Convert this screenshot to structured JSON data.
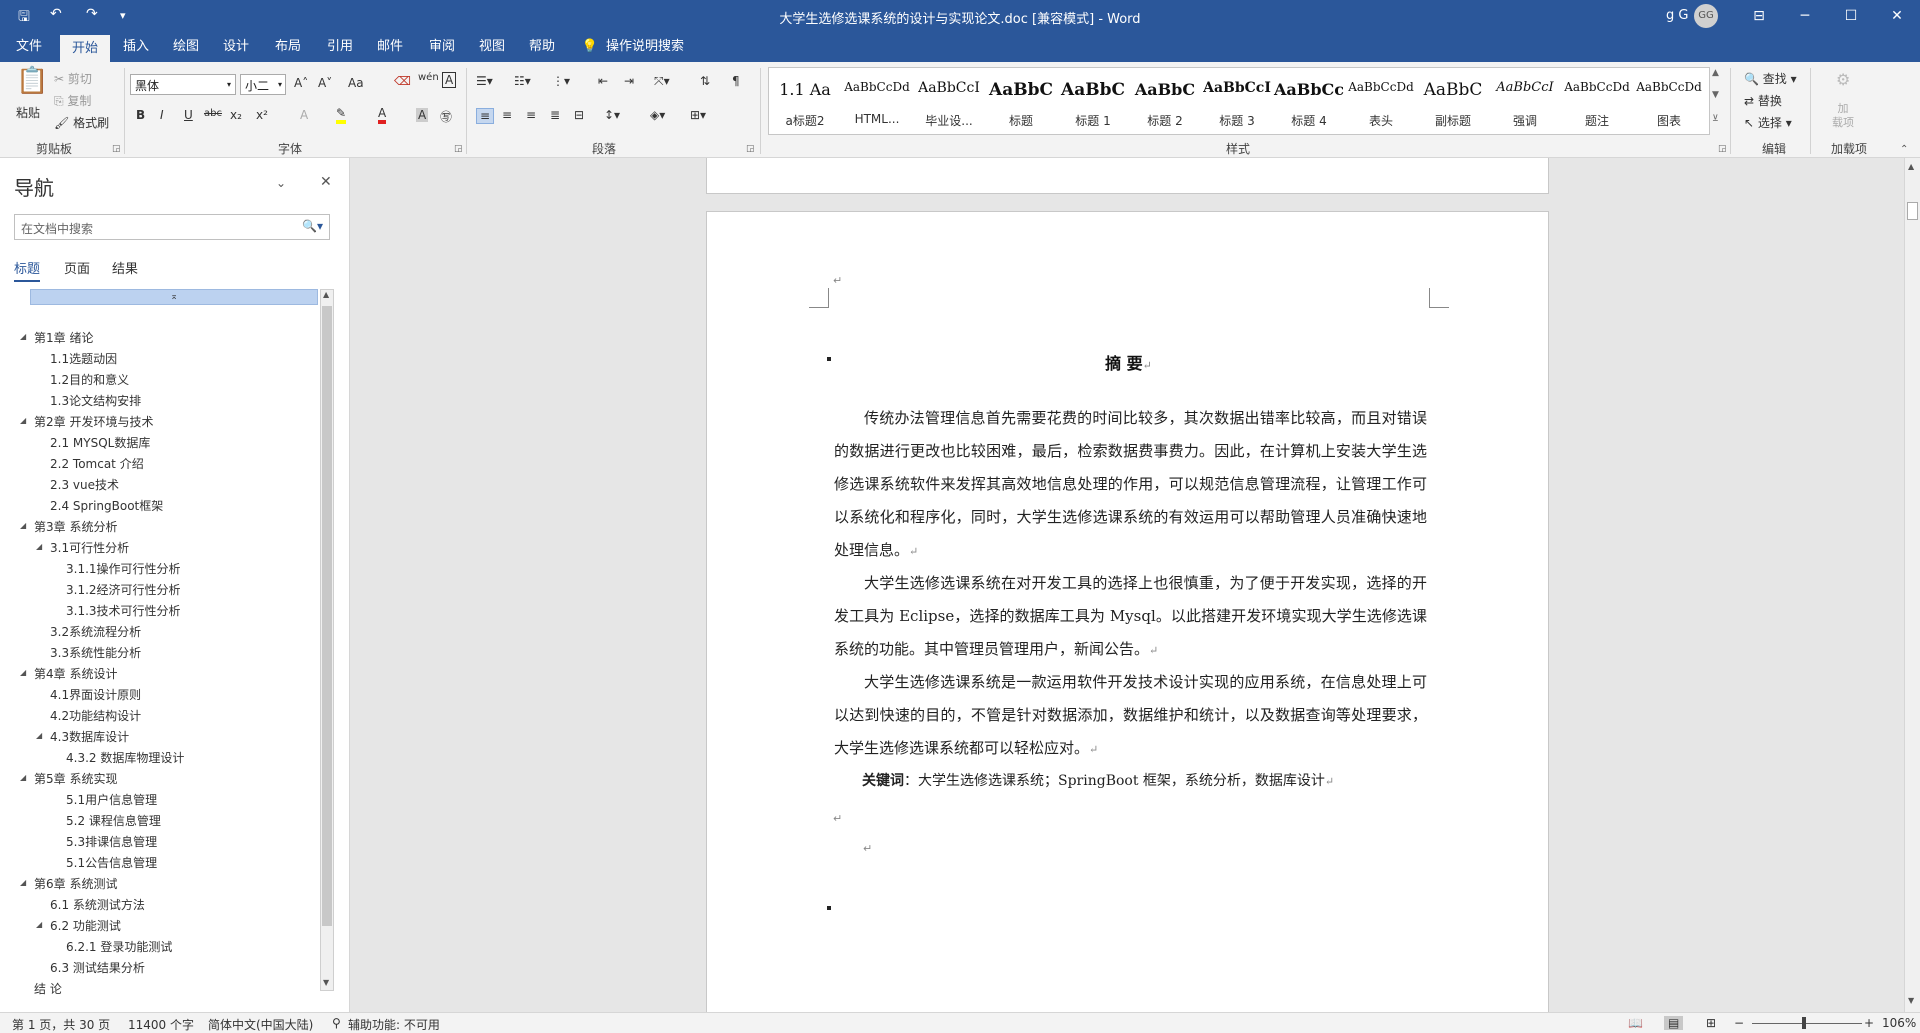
{
  "window": {
    "title": "大学生选修选课系统的设计与实现论文.doc [兼容模式] - Word",
    "user": "g G",
    "avatar_initials": "GG",
    "controls": {
      "minimize": "─",
      "maximize": "☐",
      "close": "✕",
      "ribbon_options": "⊟"
    }
  },
  "qat": {
    "save": "🖫",
    "undo": "↶",
    "redo": "↷",
    "customize": "▾"
  },
  "tabs": [
    "文件",
    "开始",
    "插入",
    "绘图",
    "设计",
    "布局",
    "引用",
    "邮件",
    "审阅",
    "视图",
    "帮助"
  ],
  "active_tab": "开始",
  "tell_me": "操作说明搜索",
  "ribbon": {
    "clipboard": {
      "paste": "粘贴",
      "cut": "剪切",
      "copy": "复制",
      "format_painter": "格式刷",
      "label": "剪贴板"
    },
    "font": {
      "name": "黑体",
      "size": "小二",
      "label": "字体",
      "grow": "A˄",
      "shrink": "A˅",
      "case": "Aa",
      "bold": "B",
      "italic": "I",
      "underline": "U",
      "strike": "abc",
      "sub": "x₂",
      "sup": "x²"
    },
    "paragraph": {
      "label": "段落"
    },
    "styles": {
      "label": "样式",
      "items": [
        {
          "preview": "1.1  Aa",
          "name": "a标题2"
        },
        {
          "preview": "AaBbCcDd",
          "name": "HTML..."
        },
        {
          "preview": "AaBbCcI",
          "name": "毕业设..."
        },
        {
          "preview": "AaBbC",
          "name": "标题"
        },
        {
          "preview": "AaBbC",
          "name": "标题 1"
        },
        {
          "preview": "AaBbC",
          "name": "标题 2"
        },
        {
          "preview": "AaBbCcI",
          "name": "标题 3"
        },
        {
          "preview": "AaBbCc",
          "name": "标题 4"
        },
        {
          "preview": "AaBbCcDd",
          "name": "表头"
        },
        {
          "preview": "AaBbC",
          "name": "副标题"
        },
        {
          "preview": "AaBbCcI",
          "name": "强调"
        },
        {
          "preview": "AaBbCcDd",
          "name": "题注"
        },
        {
          "preview": "AaBbCcDd",
          "name": "图表"
        }
      ]
    },
    "editing": {
      "find": "查找",
      "replace": "替换",
      "select": "选择",
      "label": "编辑"
    },
    "addins": {
      "button": "加\n载项",
      "label": "加载项"
    }
  },
  "nav": {
    "title": "导航",
    "search_placeholder": "在文档中搜索",
    "tabs": [
      "标题",
      "页面",
      "结果"
    ],
    "headings": [
      {
        "text": "第1章 绪论",
        "level": 1,
        "expandable": true
      },
      {
        "text": "1.1选题动因",
        "level": 2,
        "expandable": false
      },
      {
        "text": "1.2目的和意义",
        "level": 2,
        "expandable": false
      },
      {
        "text": "1.3论文结构安排",
        "level": 2,
        "expandable": false
      },
      {
        "text": "第2章 开发环境与技术",
        "level": 1,
        "expandable": true
      },
      {
        "text": "2.1 MYSQL数据库",
        "level": 2,
        "expandable": false
      },
      {
        "text": "2.2 Tomcat 介绍",
        "level": 2,
        "expandable": false
      },
      {
        "text": "2.3 vue技术",
        "level": 2,
        "expandable": false
      },
      {
        "text": "2.4 SpringBoot框架",
        "level": 2,
        "expandable": false
      },
      {
        "text": "第3章 系统分析",
        "level": 1,
        "expandable": true
      },
      {
        "text": "3.1可行性分析",
        "level": 2,
        "expandable": true
      },
      {
        "text": "3.1.1操作可行性分析",
        "level": 3,
        "expandable": false
      },
      {
        "text": "3.1.2经济可行性分析",
        "level": 3,
        "expandable": false
      },
      {
        "text": "3.1.3技术可行性分析",
        "level": 3,
        "expandable": false
      },
      {
        "text": "3.2系统流程分析",
        "level": 2,
        "expandable": false
      },
      {
        "text": "3.3系统性能分析",
        "level": 2,
        "expandable": false
      },
      {
        "text": "第4章 系统设计",
        "level": 1,
        "expandable": true
      },
      {
        "text": "4.1界面设计原则",
        "level": 2,
        "expandable": false
      },
      {
        "text": "4.2功能结构设计",
        "level": 2,
        "expandable": false
      },
      {
        "text": "4.3数据库设计",
        "level": 2,
        "expandable": true
      },
      {
        "text": "4.3.2 数据库物理设计",
        "level": 3,
        "expandable": false
      },
      {
        "text": "第5章 系统实现",
        "level": 1,
        "expandable": true
      },
      {
        "text": "5.1用户信息管理",
        "level": 3,
        "expandable": false
      },
      {
        "text": "5.2 课程信息管理",
        "level": 3,
        "expandable": false
      },
      {
        "text": "5.3排课信息管理",
        "level": 3,
        "expandable": false
      },
      {
        "text": "5.1公告信息管理",
        "level": 3,
        "expandable": false
      },
      {
        "text": "第6章 系统测试",
        "level": 1,
        "expandable": true
      },
      {
        "text": "6.1 系统测试方法",
        "level": 2,
        "expandable": false
      },
      {
        "text": "6.2 功能测试",
        "level": 2,
        "expandable": true
      },
      {
        "text": "6.2.1 登录功能测试",
        "level": 3,
        "expandable": false
      },
      {
        "text": "6.3 测试结果分析",
        "level": 2,
        "expandable": false
      },
      {
        "text": "结  论",
        "level": 1,
        "expandable": false
      }
    ]
  },
  "document": {
    "abstract_title": "摘    要",
    "paragraphs": [
      "传统办法管理信息首先需要花费的时间比较多，其次数据出错率比较高，而且对错误的数据进行更改也比较困难，最后，检索数据费事费力。因此，在计算机上安装大学生选修选课系统软件来发挥其高效地信息处理的作用，可以规范信息管理流程，让管理工作可以系统化和程序化，同时，大学生选修选课系统的有效运用可以帮助管理人员准确快速地处理信息。",
      "大学生选修选课系统在对开发工具的选择上也很慎重，为了便于开发实现，选择的开发工具为 Eclipse，选择的数据库工具为 Mysql。以此搭建开发环境实现大学生选修选课系统的功能。其中管理员管理用户，新闻公告。",
      "大学生选修选课系统是一款运用软件开发技术设计实现的应用系统，在信息处理上可以达到快速的目的，不管是针对数据添加，数据维护和统计，以及数据查询等处理要求，大学生选修选课系统都可以轻松应对。"
    ],
    "keywords_label": "关键词",
    "keywords": "：大学生选修选课系统；SpringBoot 框架，系统分析，数据库设计",
    "para_mark": "↵"
  },
  "status": {
    "page": "第 1 页，共 30 页",
    "words": "11400 个字",
    "language": "简体中文(中国大陆)",
    "accessibility": "辅助功能: 不可用",
    "zoom": "106%"
  }
}
